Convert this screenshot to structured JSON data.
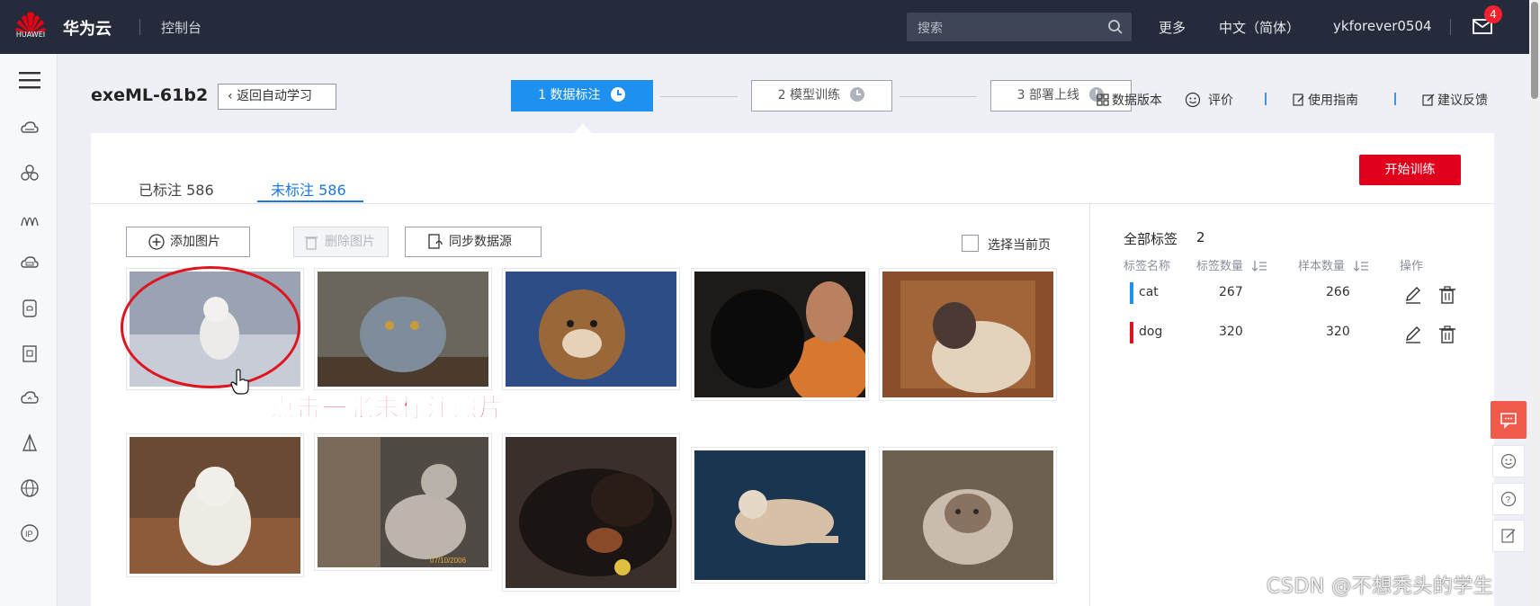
{
  "topbar": {
    "logo_text": "HUAWEI",
    "brand": "华为云",
    "console": "控制台",
    "search_placeholder": "搜索",
    "more": "更多",
    "language": "中文（简体）",
    "username": "ykforever0504",
    "mail_badge": "4"
  },
  "header": {
    "project_name": "exeML-61b2",
    "back_label": "返回自动学习",
    "steps": [
      {
        "label": "1 数据标注",
        "state": "active"
      },
      {
        "label": "2 模型训练",
        "state": "pending"
      },
      {
        "label": "3 部署上线",
        "state": "pending"
      }
    ],
    "links": {
      "data_version": "数据版本",
      "rate": "评价",
      "guide": "使用指南",
      "feedback": "建议反馈"
    }
  },
  "tabs": {
    "labeled": "已标注 586",
    "unlabeled": "未标注 586",
    "active": "unlabeled"
  },
  "toolbar": {
    "train_button": "开始训练",
    "add_images": "添加图片",
    "delete_images": "删除图片",
    "sync_source": "同步数据源",
    "select_page": "选择当前页"
  },
  "images": [
    {
      "subject": "white dog in snow",
      "bg": "#8f99a8",
      "fg": "#e8e8ea"
    },
    {
      "subject": "grey cat on ledge",
      "bg": "#5e5a52",
      "fg": "#7e8a98"
    },
    {
      "subject": "shiba puppy on blue",
      "bg": "#2f4e87",
      "fg": "#9c6a3e"
    },
    {
      "subject": "black dog with man",
      "bg": "#1f1b18",
      "fg": "#d47a33"
    },
    {
      "subject": "siamese cat in box",
      "bg": "#8a4e2a",
      "fg": "#e3d3bd"
    },
    {
      "subject": "white fluffy dog on rug",
      "bg": "#6b4a33",
      "fg": "#ebe7e0"
    },
    {
      "subject": "spotted cat by door",
      "bg": "#5a4f45",
      "fg": "#b9b2a8"
    },
    {
      "subject": "black and tan dog",
      "bg": "#2a211d",
      "fg": "#8a4a2a"
    },
    {
      "subject": "dog lying on blue carpet",
      "bg": "#1a3550",
      "fg": "#d7c0a5"
    },
    {
      "subject": "ragdoll cat on floor",
      "bg": "#6e6050",
      "fg": "#c9bcae"
    }
  ],
  "annotation": "点击一张未标注照片",
  "labels_panel": {
    "title": "全部标签",
    "count": "2",
    "col_name": "标签名称",
    "col_label_count": "标签数量",
    "col_sample_count": "样本数量",
    "col_action": "操作",
    "rows": [
      {
        "name": "cat",
        "label_count": "267",
        "sample_count": "266",
        "color": "#1e90ef"
      },
      {
        "name": "dog",
        "label_count": "320",
        "sample_count": "320",
        "color": "#e0141e"
      }
    ]
  },
  "watermark": "CSDN @不想秃头的学生",
  "colors": {
    "topbar": "#252b3a",
    "accent": "#1e90ef",
    "train": "#e0001b"
  }
}
